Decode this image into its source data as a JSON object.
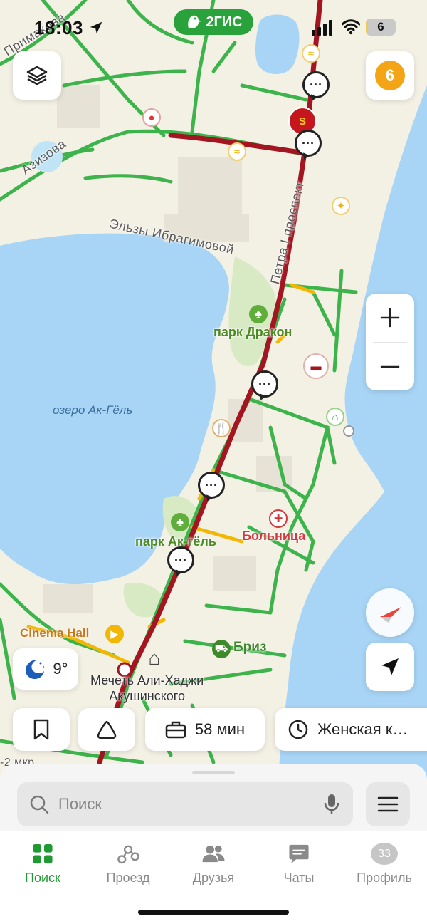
{
  "status_bar": {
    "time": "18:03",
    "app_logo": "2ГИС",
    "battery_level": "6",
    "battery_fraction": 0.06
  },
  "map": {
    "notifications_count": "6",
    "streets": {
      "street_azizova": "Азизова",
      "street_primakova": "Примакова",
      "street_ibragimovoy": "Эльзы Ибрагимовой",
      "street_petra": "Петра I проспект"
    },
    "places": {
      "park_drakon": "парк Дракон",
      "park_ak_gel": "парк Ак-гёль",
      "lake": "озеро Ак-Гёль",
      "hospital": "Больница",
      "cinema": "Cinema Hall",
      "briz": "Бриз",
      "mosque_line1": "Мечеть Али-Хаджи",
      "mosque_line2": "Акушинского",
      "mkr": "-2 мкр"
    },
    "weather_temp": "9°",
    "compass_icon": "compass-icon",
    "colors": {
      "water": "#a8d4f5",
      "land": "#f3f0e4",
      "traffic_green": "#3cb44b",
      "traffic_red": "#a31621",
      "traffic_yellow": "#f2b705",
      "park": "#d7eac3"
    }
  },
  "chips": {
    "travel_time": "58 мин",
    "destination": "Женская к…"
  },
  "search": {
    "placeholder": "Поиск"
  },
  "tabs": [
    {
      "label": "Поиск",
      "icon": "grid-icon",
      "active": true
    },
    {
      "label": "Проезд",
      "icon": "transit-icon",
      "active": false
    },
    {
      "label": "Друзья",
      "icon": "friends-icon",
      "active": false
    },
    {
      "label": "Чаты",
      "icon": "chat-icon",
      "active": false
    },
    {
      "label": "Профиль",
      "icon": "profile-avatar",
      "active": false,
      "badge": "33"
    }
  ]
}
